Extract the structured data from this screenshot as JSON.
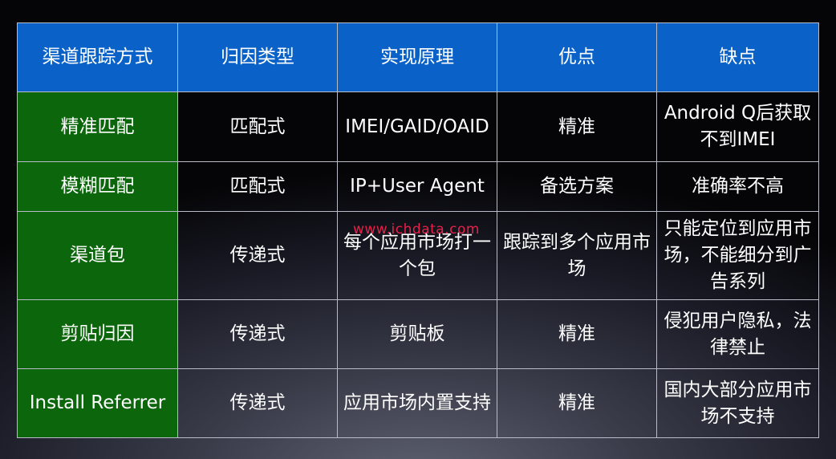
{
  "header": [
    "渠道跟踪方式",
    "归因类型",
    "实现原理",
    "优点",
    "缺点"
  ],
  "rows": [
    [
      "精准匹配",
      "匹配式",
      "IMEI/GAID/OAID",
      "精准",
      "Android Q后获取不到IMEI"
    ],
    [
      "模糊匹配",
      "匹配式",
      "IP+User Agent",
      "备选方案",
      "准确率不高"
    ],
    [
      "渠道包",
      "传递式",
      "每个应用市场打一个包",
      "跟踪到多个应用市场",
      "只能定位到应用市场，不能细分到广告系列"
    ],
    [
      "剪贴归因",
      "传递式",
      "剪贴板",
      "精准",
      "侵犯用户隐私，法律禁止"
    ],
    [
      "Install Referrer",
      "传递式",
      "应用市场内置支持",
      "精准",
      "国内大部分应用市场不支持"
    ]
  ],
  "watermark": "www.ichdata.com",
  "colors": {
    "header_bg": "#0a62c8",
    "first_col_bg": "#0c660c",
    "border": "#b9bcc8",
    "watermark": "#e8204a"
  }
}
